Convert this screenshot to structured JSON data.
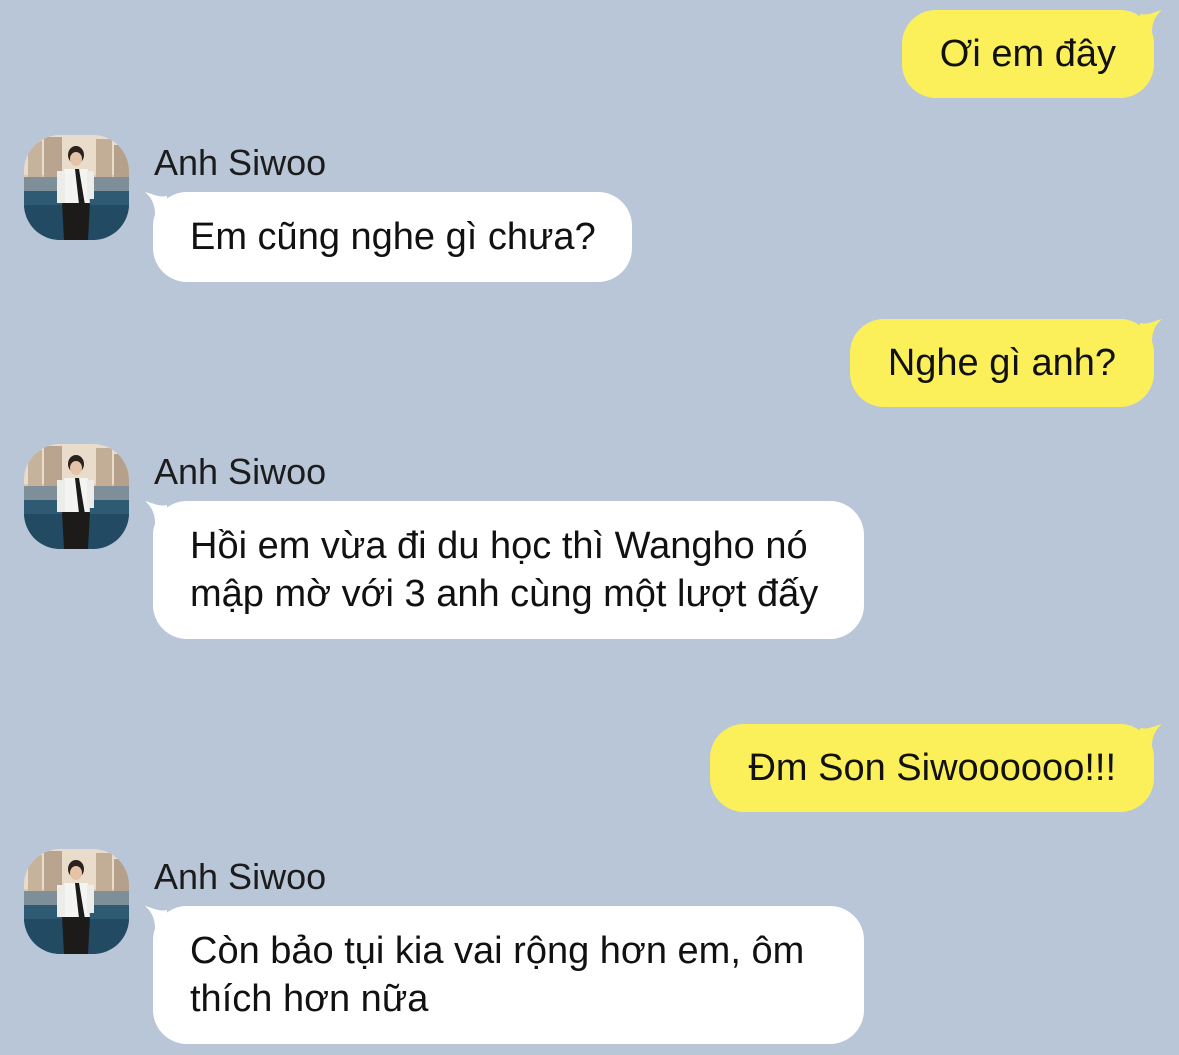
{
  "messages": [
    {
      "type": "outgoing",
      "text": "Ơi em đây"
    },
    {
      "type": "incoming",
      "sender": "Anh Siwoo",
      "text": "Em cũng nghe gì chưa?"
    },
    {
      "type": "outgoing",
      "text": "Nghe gì anh?"
    },
    {
      "type": "incoming",
      "sender": "Anh Siwoo",
      "text": "Hồi em vừa đi du học thì Wangho nó mập mờ với 3 anh cùng một lượt đấy"
    },
    {
      "type": "outgoing",
      "text": "Đm Son Siwoooooo!!!"
    },
    {
      "type": "incoming",
      "sender": "Anh Siwoo",
      "text": "Còn bảo tụi kia vai rộng hơn em, ôm thích hơn nữa"
    }
  ],
  "colors": {
    "background": "#b9c6d8",
    "outgoing_bubble": "#fbf05a",
    "incoming_bubble": "#ffffff"
  }
}
